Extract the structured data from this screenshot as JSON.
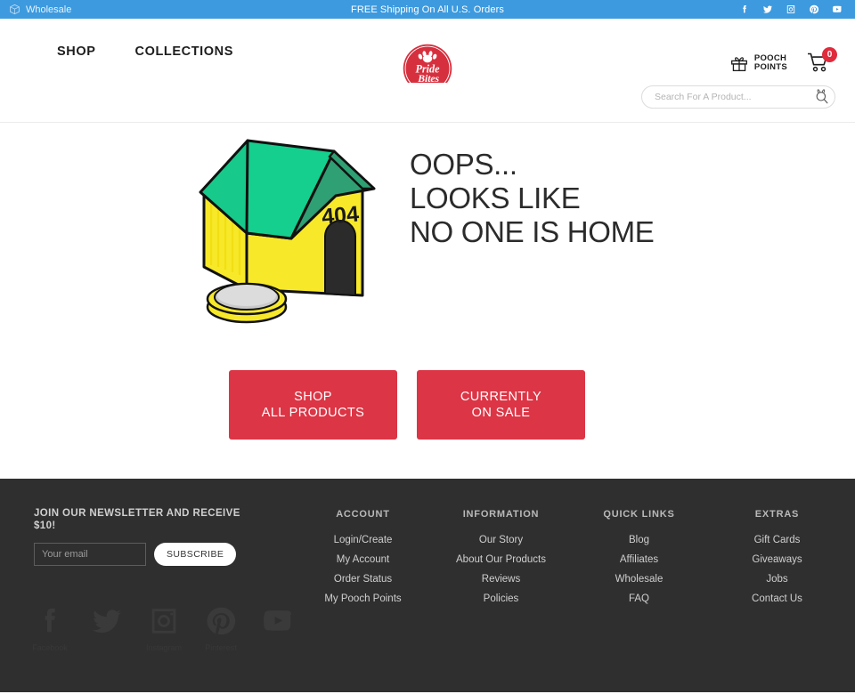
{
  "topbar": {
    "wholesale_label": "Wholesale",
    "wholesale_icon": "box-icon",
    "shipping_message": "FREE Shipping On All U.S. Orders",
    "social": [
      {
        "name": "facebook-icon",
        "label": "Facebook"
      },
      {
        "name": "twitter-icon",
        "label": "Twitter"
      },
      {
        "name": "instagram-icon",
        "label": "Instagram"
      },
      {
        "name": "pinterest-icon",
        "label": "Pinterest"
      },
      {
        "name": "youtube-icon",
        "label": "YouTube"
      }
    ],
    "bg_color": "#3d9ade"
  },
  "header": {
    "nav": [
      {
        "label": "SHOP"
      },
      {
        "label": "COLLECTIONS"
      }
    ],
    "logo": {
      "name": "pridebites-logo",
      "line1": "Pride",
      "line2": "Bites"
    },
    "pooch_points": {
      "line1": "POOCH",
      "line2": "POINTS",
      "icon": "gift-icon"
    },
    "cart": {
      "icon": "cart-icon",
      "count": "0",
      "badge_color": "#e02b3c"
    }
  },
  "search": {
    "placeholder": "Search For A Product...",
    "value": "",
    "button_icon": "search-icon"
  },
  "hero": {
    "illustration": "doghouse-404-illustration",
    "doghouse_number": "404",
    "heading": "OOPS...\nLOOKS LIKE\nNO ONE IS HOME",
    "buttons": [
      {
        "label": "SHOP\nALL PRODUCTS",
        "color": "#dc3545"
      },
      {
        "label": "CURRENTLY\nON SALE",
        "color": "#dc3545"
      }
    ]
  },
  "footer": {
    "bg_color": "#2f2f2f",
    "newsletter": {
      "title": "JOIN OUR NEWSLETTER AND RECEIVE $10!",
      "email_placeholder": "Your email",
      "email_value": "",
      "subscribe_label": "SUBSCRIBE"
    },
    "columns": [
      {
        "title": "ACCOUNT",
        "links": [
          {
            "label": "Login/Create"
          },
          {
            "label": "My Account"
          },
          {
            "label": "Order Status"
          },
          {
            "label": "My Pooch Points"
          }
        ]
      },
      {
        "title": "INFORMATION",
        "links": [
          {
            "label": "Our Story"
          },
          {
            "label": "About Our Products"
          },
          {
            "label": "Reviews"
          },
          {
            "label": "Policies"
          }
        ]
      },
      {
        "title": "QUICK LINKS",
        "links": [
          {
            "label": "Blog"
          },
          {
            "label": "Affiliates"
          },
          {
            "label": "Wholesale"
          },
          {
            "label": "FAQ"
          }
        ]
      },
      {
        "title": "EXTRAS",
        "links": [
          {
            "label": "Gift Cards"
          },
          {
            "label": "Giveaways"
          },
          {
            "label": "Jobs"
          },
          {
            "label": "Contact Us"
          }
        ]
      }
    ],
    "social": [
      {
        "name": "facebook-icon",
        "label": "Facebook"
      },
      {
        "name": "twitter-icon",
        "label": ""
      },
      {
        "name": "instagram-icon",
        "label": "Instagram"
      },
      {
        "name": "pinterest-icon",
        "label": "Pinterest"
      },
      {
        "name": "youtube-icon",
        "label": ""
      }
    ]
  }
}
